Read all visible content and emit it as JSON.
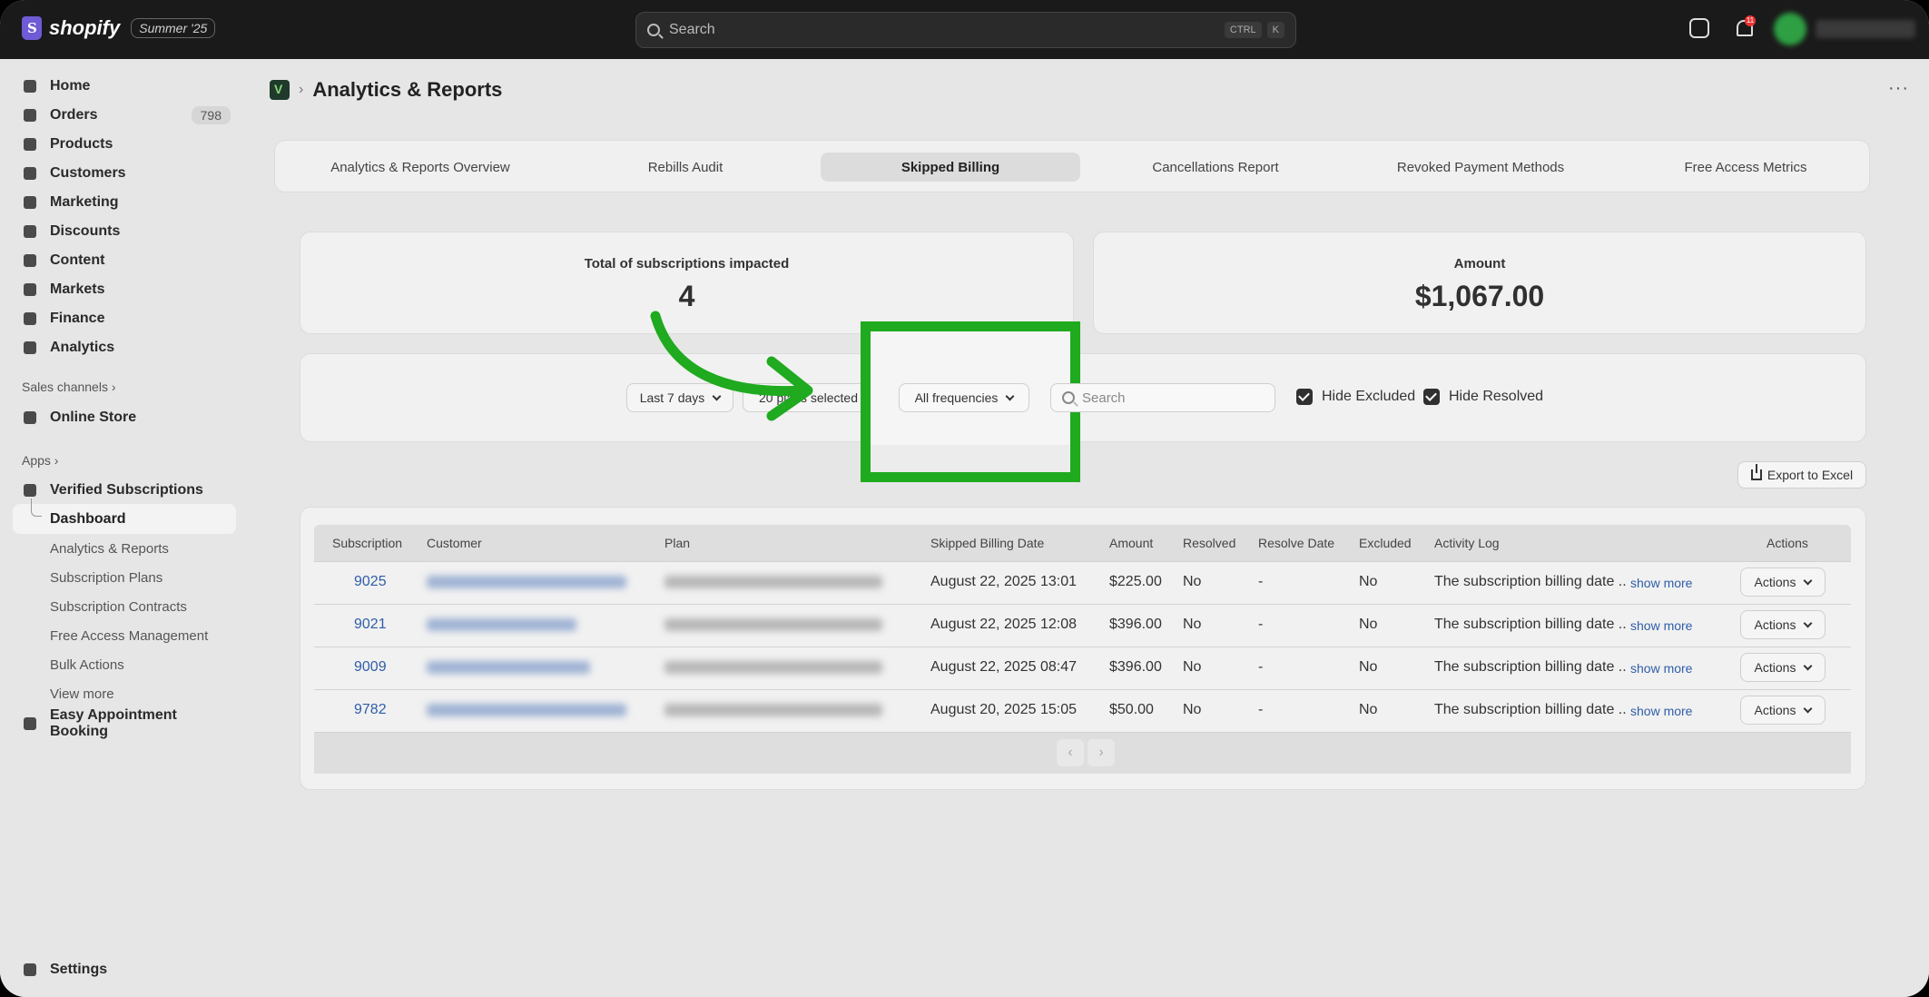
{
  "topbar": {
    "logo_text": "shopify",
    "edition_badge": "Summer '25",
    "search_placeholder": "Search",
    "kbd_ctrl": "CTRL",
    "kbd_k": "K",
    "notification_count": "11"
  },
  "sidebar": {
    "items": [
      {
        "label": "Home",
        "icon": "home-icon"
      },
      {
        "label": "Orders",
        "icon": "inbox-icon",
        "badge": "798"
      },
      {
        "label": "Products",
        "icon": "tag-icon"
      },
      {
        "label": "Customers",
        "icon": "person-icon"
      },
      {
        "label": "Marketing",
        "icon": "target-icon"
      },
      {
        "label": "Discounts",
        "icon": "discount-icon"
      },
      {
        "label": "Content",
        "icon": "content-icon"
      },
      {
        "label": "Markets",
        "icon": "globe-icon"
      },
      {
        "label": "Finance",
        "icon": "bank-icon"
      },
      {
        "label": "Analytics",
        "icon": "bar-chart-icon"
      }
    ],
    "sales_channels_label": "Sales channels",
    "online_store": "Online Store",
    "apps_label": "Apps",
    "verified_subscriptions": "Verified Subscriptions",
    "dashboard": "Dashboard",
    "sub_items": [
      "Analytics & Reports",
      "Subscription Plans",
      "Subscription Contracts",
      "Free Access Management",
      "Bulk Actions",
      "View more"
    ],
    "easy_appointment": "Easy Appointment Booking",
    "settings": "Settings"
  },
  "header": {
    "title": "Analytics & Reports",
    "separator": "›",
    "more": "···"
  },
  "tabs": [
    {
      "label": "Analytics & Reports Overview"
    },
    {
      "label": "Rebills Audit"
    },
    {
      "label": "Skipped Billing"
    },
    {
      "label": "Cancellations Report"
    },
    {
      "label": "Revoked Payment Methods"
    },
    {
      "label": "Free Access Metrics"
    }
  ],
  "metrics": {
    "subscriptions_label": "Total of subscriptions impacted",
    "subscriptions_value": "4",
    "amount_label": "Amount",
    "amount_value": "$1,067.00"
  },
  "filters": {
    "date_range": "Last 7 days",
    "plans": "20 plans selected",
    "frequency": "All frequencies",
    "search_placeholder": "Search",
    "hide_excluded": "Hide Excluded",
    "hide_resolved": "Hide Resolved"
  },
  "export_label": "Export to Excel",
  "table": {
    "headers": [
      "Subscription",
      "Customer",
      "Plan",
      "Skipped Billing Date",
      "Amount",
      "Resolved",
      "Resolve Date",
      "Excluded",
      "Activity Log",
      "Actions"
    ],
    "rows": [
      {
        "id": "9025",
        "date": "August 22, 2025 13:01",
        "amount": "$225.00",
        "resolved": "No",
        "resolve_date": "-",
        "excluded": "No",
        "log": "The subscription billing date ..",
        "more": "show more",
        "action": "Actions"
      },
      {
        "id": "9021",
        "date": "August 22, 2025 12:08",
        "amount": "$396.00",
        "resolved": "No",
        "resolve_date": "-",
        "excluded": "No",
        "log": "The subscription billing date ..",
        "more": "show more",
        "action": "Actions"
      },
      {
        "id": "9009",
        "date": "August 22, 2025 08:47",
        "amount": "$396.00",
        "resolved": "No",
        "resolve_date": "-",
        "excluded": "No",
        "log": "The subscription billing date ..",
        "more": "show more",
        "action": "Actions"
      },
      {
        "id": "9782",
        "date": "August 20, 2025 15:05",
        "amount": "$50.00",
        "resolved": "No",
        "resolve_date": "-",
        "excluded": "No",
        "log": "The subscription billing date ..",
        "more": "show more",
        "action": "Actions"
      }
    ],
    "pager_prev": "‹",
    "pager_next": "›"
  },
  "colors": {
    "highlight": "#1faa1f",
    "link": "#2f5ea8"
  }
}
